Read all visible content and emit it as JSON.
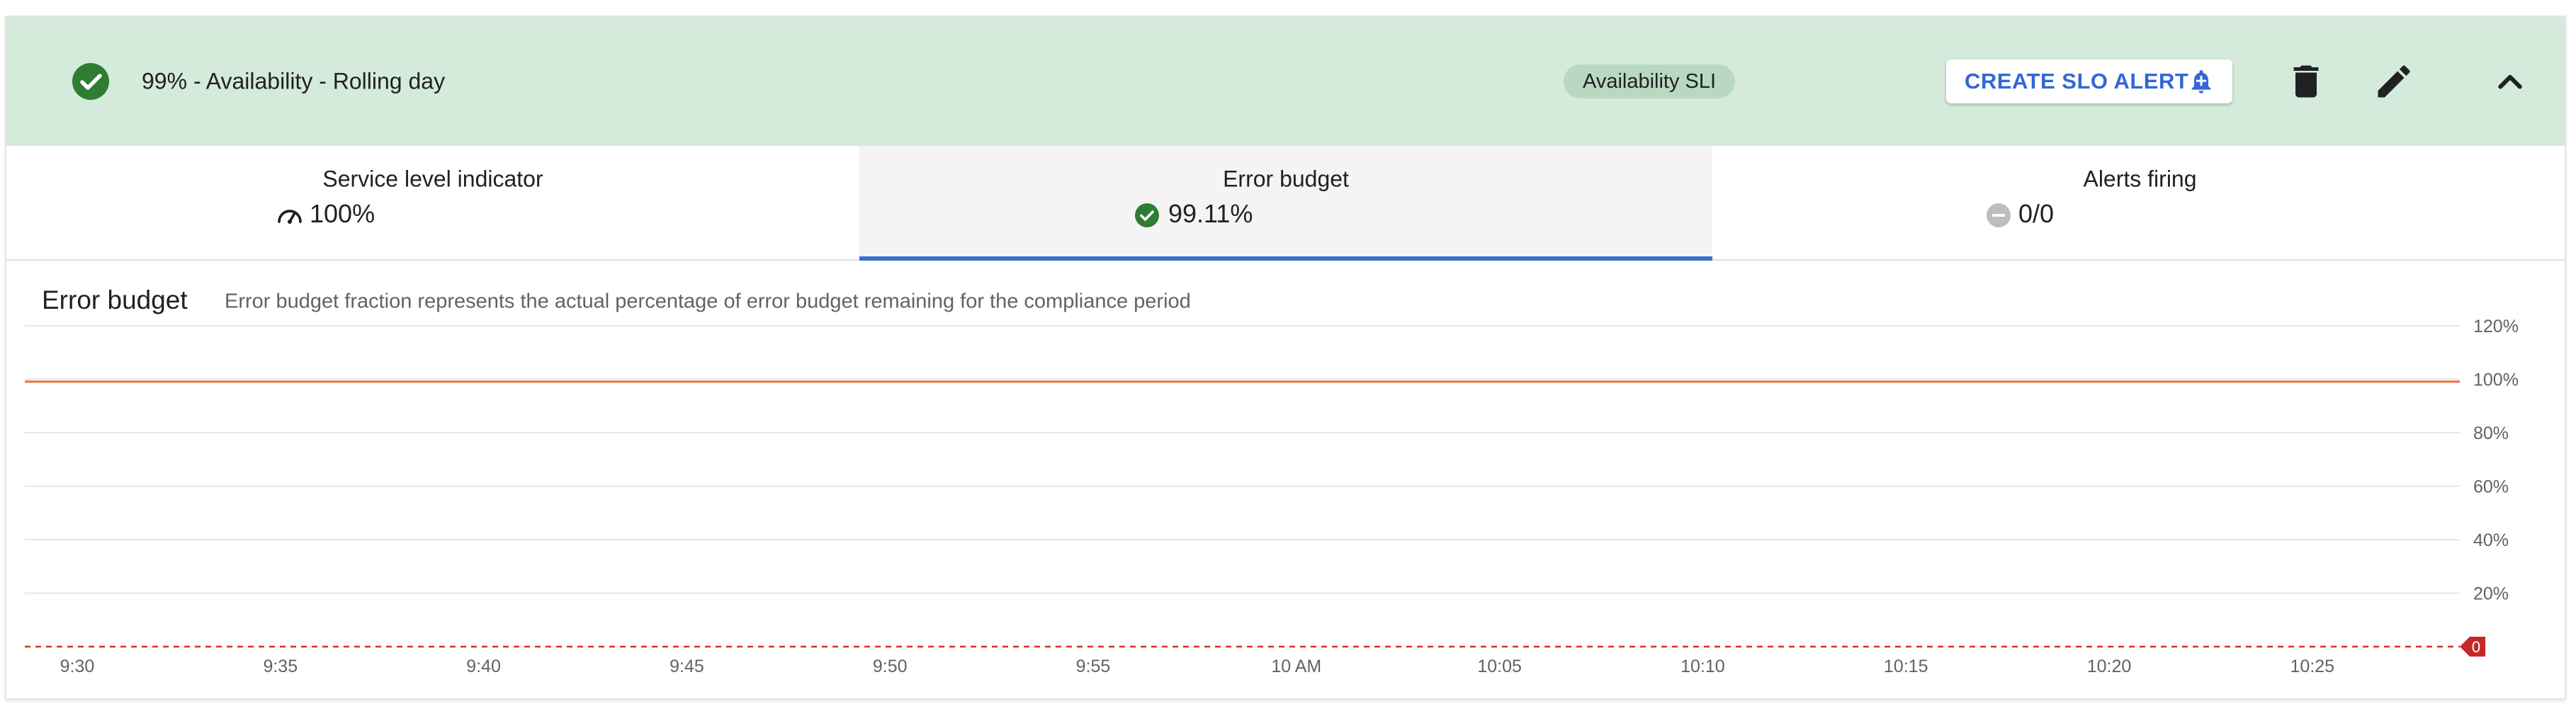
{
  "slo": {
    "title": "99% - Availability - Rolling day",
    "sli_chip": "Availability SLI",
    "create_alert_label": "CREATE SLO ALERT",
    "icons": {
      "status": "check-circle-icon",
      "alert": "bell-plus-icon",
      "delete": "delete-icon",
      "edit": "edit-icon",
      "collapse": "chevron-up-icon"
    }
  },
  "colors": {
    "header_bg": "#d4eadb",
    "ok_green": "#2e7d32",
    "link_blue": "#3367d6",
    "series_orange": "#e8703a",
    "threshold_red": "#d93025"
  },
  "tabs": [
    {
      "label": "Service level indicator",
      "value": "100%",
      "icon": "gauge-icon"
    },
    {
      "label": "Error budget",
      "value": "99.11%",
      "icon": "check-circle-icon",
      "active": true
    },
    {
      "label": "Alerts firing",
      "value": "0/0",
      "icon": "remove-circle-icon"
    }
  ],
  "panel": {
    "title": "Error budget",
    "description": "Error budget fraction represents the actual percentage of error budget remaining for the compliance period"
  },
  "chart_data": {
    "type": "line",
    "title": "",
    "xlabel": "",
    "ylabel": "",
    "x_ticks": [
      "9:30",
      "9:35",
      "9:40",
      "9:45",
      "9:50",
      "9:55",
      "10 AM",
      "10:05",
      "10:10",
      "10:15",
      "10:20",
      "10:25"
    ],
    "y_ticks": [
      "120%",
      "100%",
      "80%",
      "60%",
      "40%",
      "20%"
    ],
    "ylim": [
      0,
      120
    ],
    "grid": true,
    "series": [
      {
        "values": [
          99.11,
          99.11,
          99.11,
          99.11,
          99.11,
          99.11,
          99.11,
          99.11,
          99.11,
          99.11,
          99.11,
          99.11,
          99.11
        ]
      }
    ],
    "threshold": {
      "value": 0,
      "label": "0",
      "style": "dashed"
    }
  }
}
